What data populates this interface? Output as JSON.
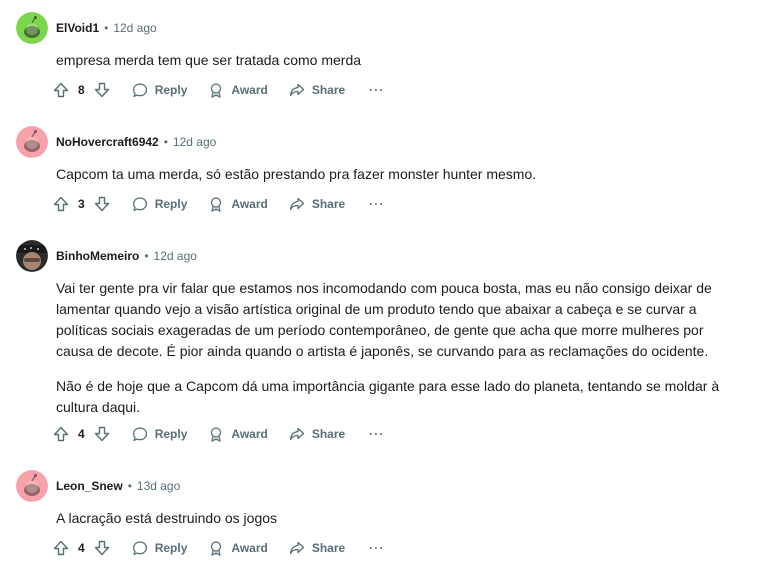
{
  "comments": [
    {
      "author": "ElVoid1",
      "sep": "•",
      "time": "12d ago",
      "paragraphs": [
        "empresa merda tem que ser tratada como merda"
      ],
      "score": "8",
      "reply": "Reply",
      "award": "Award",
      "share": "Share",
      "more": "···",
      "avatar_color": "#7bd64b"
    },
    {
      "author": "NoHovercraft6942",
      "sep": "•",
      "time": "12d ago",
      "paragraphs": [
        "Capcom ta uma merda, só estão prestando pra fazer monster hunter mesmo."
      ],
      "score": "3",
      "reply": "Reply",
      "award": "Award",
      "share": "Share",
      "more": "···",
      "avatar_color": "#f7a1a8"
    },
    {
      "author": "BinhoMemeiro",
      "sep": "•",
      "time": "12d ago",
      "paragraphs": [
        "Vai ter gente pra vir falar que estamos nos incomodando com pouca bosta, mas eu não consigo deixar de lamentar quando vejo a visão artística original de um produto tendo que abaixar a cabeça e se curvar a políticas sociais exageradas de um período contemporâneo, de gente que acha que morre mulheres por causa de decote. É pior ainda quando o artista é japonês, se curvando para as reclamações do ocidente.",
        "Não é de hoje que a Capcom dá uma importância gigante para esse lado do planeta, tentando se moldar à cultura daqui."
      ],
      "score": "4",
      "reply": "Reply",
      "award": "Award",
      "share": "Share",
      "more": "···",
      "avatar_color": "#2b2b2b"
    },
    {
      "author": "Leon_Snew",
      "sep": "•",
      "time": "13d ago",
      "paragraphs": [
        "A lacração está destruindo os jogos"
      ],
      "score": "4",
      "reply": "Reply",
      "award": "Award",
      "share": "Share",
      "more": "···",
      "avatar_color": "#f7a1a8"
    }
  ]
}
